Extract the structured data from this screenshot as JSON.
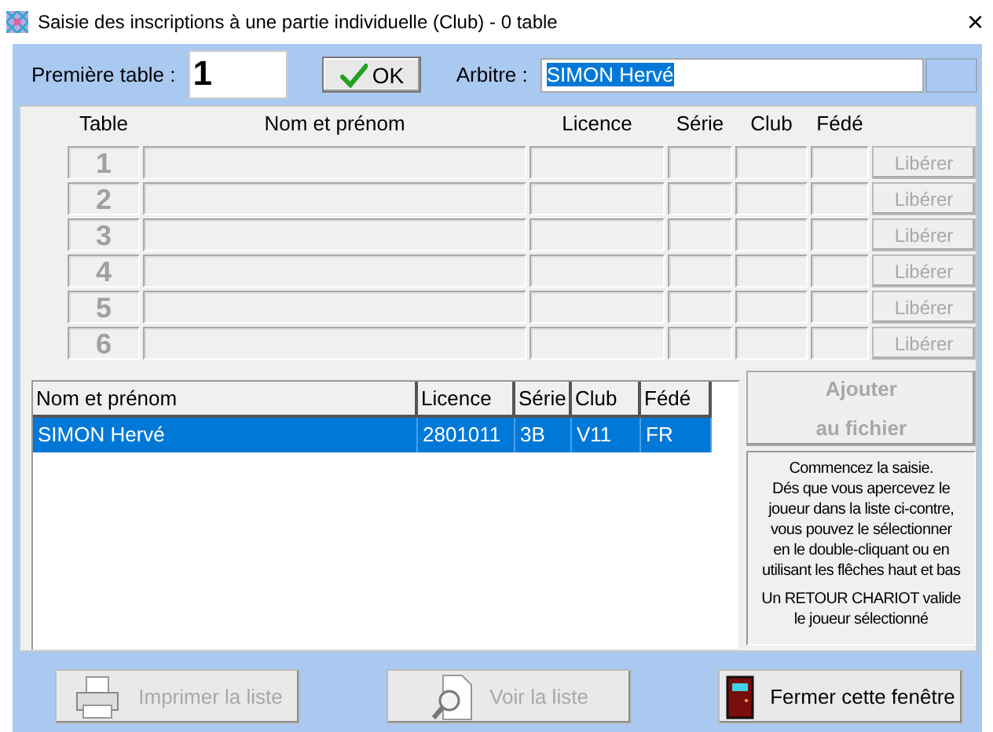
{
  "window": {
    "title": "Saisie des inscriptions à une partie individuelle (Club) - 0 table",
    "close": "×"
  },
  "first_table": {
    "label": "Première table :",
    "value": "1"
  },
  "ok_button": {
    "label": "OK"
  },
  "referee": {
    "label": "Arbitre :",
    "value": "SIMON Hervé",
    "highlighted": true
  },
  "tables": {
    "columns": [
      "Table",
      "Nom et prénom",
      "Licence",
      "Série",
      "Club",
      "Fédé"
    ],
    "rows": [
      {
        "number": "1",
        "button": "Libérer",
        "disabled": true
      },
      {
        "number": "2",
        "button": "Libérer",
        "disabled": true
      },
      {
        "number": "3",
        "button": "Libérer",
        "disabled": true
      },
      {
        "number": "4",
        "button": "Libérer",
        "disabled": true
      },
      {
        "number": "5",
        "button": "Libérer",
        "disabled": true
      },
      {
        "number": "6",
        "button": "Libérer",
        "disabled": true
      }
    ]
  },
  "player_list": {
    "columns": [
      "Nom et prénom",
      "Licence",
      "Série",
      "Club",
      "Fédé"
    ],
    "rows": [
      {
        "cells": [
          "SIMON Hervé",
          "2801011",
          "3B",
          "V11",
          "FR"
        ],
        "selected": true
      }
    ]
  },
  "add_button": {
    "lines": [
      "Ajouter",
      "au fichier"
    ],
    "disabled": true
  },
  "help": {
    "paragraphs": [
      "Commencez la saisie.\nDés que vous apercevez le\njoueur dans la liste ci-contre,\nvous pouvez le sélectionner\nen le double-cliquant ou en\nutilisant les flêches haut et bas",
      "Un RETOUR CHARIOT valide\nle joueur sélectionné"
    ]
  },
  "bottom_buttons": [
    {
      "label": "Imprimer la liste",
      "kind": "print",
      "disabled": true
    },
    {
      "label": "Voir la liste",
      "kind": "view",
      "disabled": true
    },
    {
      "label": "Fermer cette fenêtre",
      "kind": "close",
      "disabled": false
    }
  ]
}
